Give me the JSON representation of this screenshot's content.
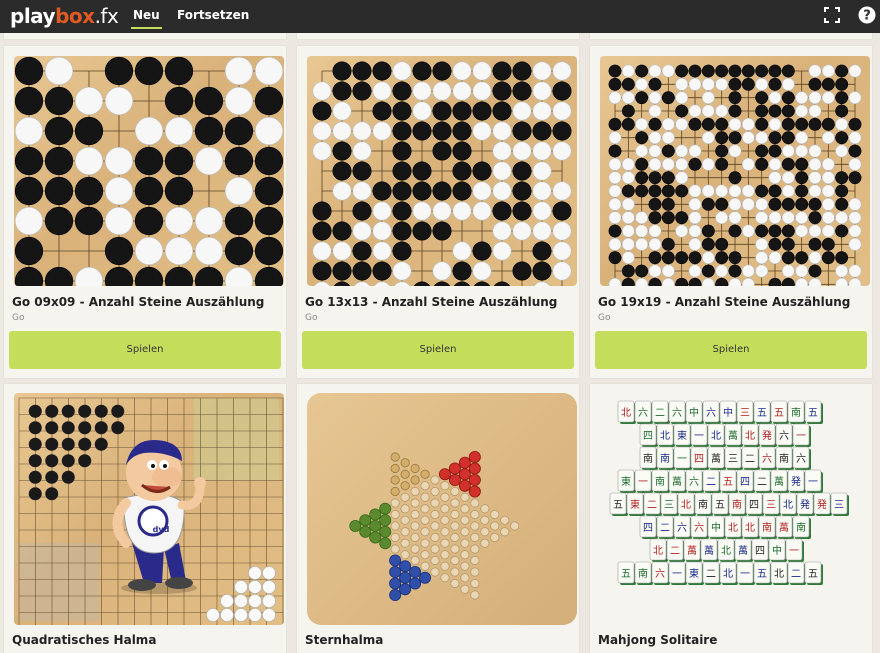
{
  "header": {
    "logo": {
      "part1": "play",
      "part2": "box",
      "part3": ".fx"
    },
    "nav": [
      {
        "label": "Neu"
      },
      {
        "label": "Fortsetzen"
      }
    ],
    "icons": [
      "fullscreen-icon",
      "help-icon"
    ]
  },
  "cards": [
    {
      "title": "Go 09x09 - Anzahl Steine Auszählung",
      "subtitle": "Go",
      "button": "Spielen"
    },
    {
      "title": "Go 13x13 - Anzahl Steine Auszählung",
      "subtitle": "Go",
      "button": "Spielen"
    },
    {
      "title": "Go 19x19 - Anzahl Steine Auszählung",
      "subtitle": "Go",
      "button": "Spielen"
    },
    {
      "title": "Quadratisches Halma"
    },
    {
      "title": "Sternhalma"
    },
    {
      "title": "Mahjong Solitaire"
    }
  ],
  "mascot_badge": "dvd",
  "colors": {
    "accent": "#c4de5b",
    "brand_orange": "#e05a22",
    "topbar": "#2b2b2b"
  }
}
